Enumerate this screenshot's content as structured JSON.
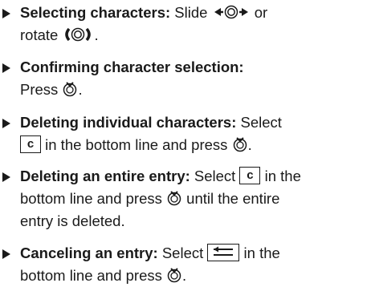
{
  "items": [
    {
      "label": "Selecting characters:",
      "part1": " Slide ",
      "part2": " or",
      "part3": "rotate ",
      "part4": "."
    },
    {
      "label": "Confirming character selection:",
      "part1": "Press ",
      "part2": "."
    },
    {
      "label": "Deleting individual characters:",
      "part1": " Select",
      "part2": " in the bottom line and press ",
      "part3": "."
    },
    {
      "label": "Deleting an entire entry:",
      "part1": " Select ",
      "part2": " in the",
      "part3": "bottom line and press ",
      "part4": " until the entire",
      "part5": "entry is deleted."
    },
    {
      "label": "Canceling an entry:",
      "part1": " Select ",
      "part2": " in the",
      "part3": "bottom line and press ",
      "part4": "."
    }
  ],
  "keys": {
    "c_label": "c"
  },
  "icons": {
    "slide": "controller-slide-left-right-icon",
    "rotate": "controller-rotate-icon",
    "press": "controller-press-icon",
    "back": "back-arrow-key-icon"
  }
}
